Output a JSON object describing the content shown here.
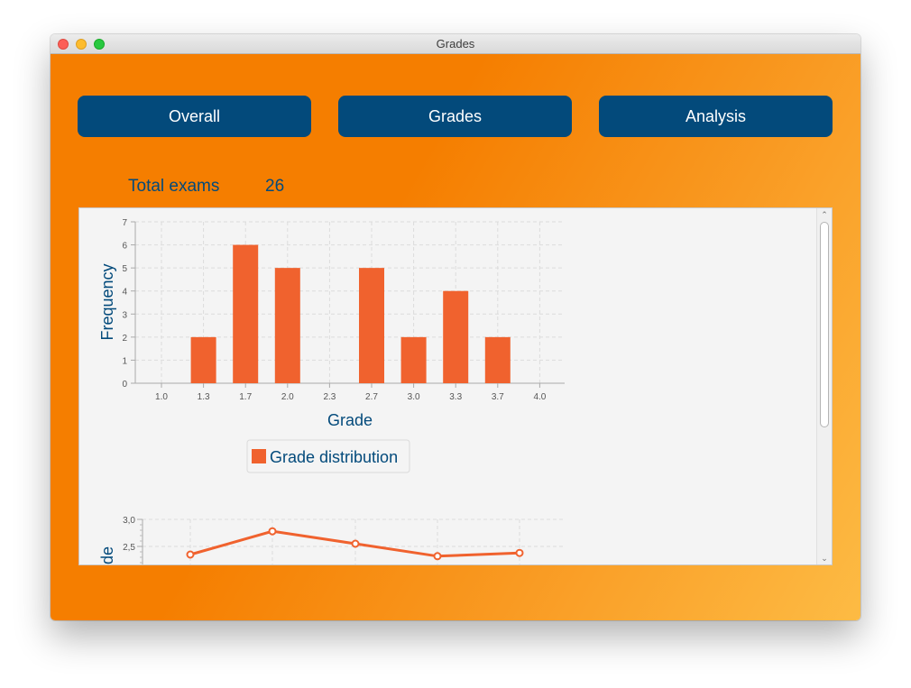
{
  "window": {
    "title": "Grades"
  },
  "nav": {
    "overall": "Overall",
    "grades": "Grades",
    "analysis": "Analysis"
  },
  "stats": {
    "total_exams_label": "Total exams",
    "total_exams_value": "26"
  },
  "colors": {
    "accent": "#f57e00",
    "nav_button": "#034a7b",
    "bar": "#f0622e",
    "axis_text": "#034a7b"
  },
  "chart_data": [
    {
      "type": "bar",
      "categories": [
        "1.0",
        "1.3",
        "1.7",
        "2.0",
        "2.3",
        "2.7",
        "3.0",
        "3.3",
        "3.7",
        "4.0"
      ],
      "values": [
        0,
        2,
        6,
        5,
        0,
        5,
        2,
        4,
        2,
        0
      ],
      "yticks": [
        "0",
        "1",
        "2",
        "3",
        "4",
        "5",
        "6",
        "7"
      ],
      "xlabel": "Grade",
      "ylabel": "Frequency",
      "ylim": [
        0,
        7
      ],
      "grid": true,
      "legend": {
        "label": "Grade distribution",
        "placement": "bottom"
      }
    },
    {
      "type": "line",
      "values": [
        2.35,
        2.78,
        2.55,
        2.32,
        2.38
      ],
      "yticks": [
        "2,5",
        "3,0"
      ],
      "ylabel": "Average grade",
      "ylabel_visible": "de",
      "grid": true
    }
  ],
  "icons": {
    "scroll_up": "chevron-up-icon",
    "scroll_down": "chevron-down-icon"
  }
}
